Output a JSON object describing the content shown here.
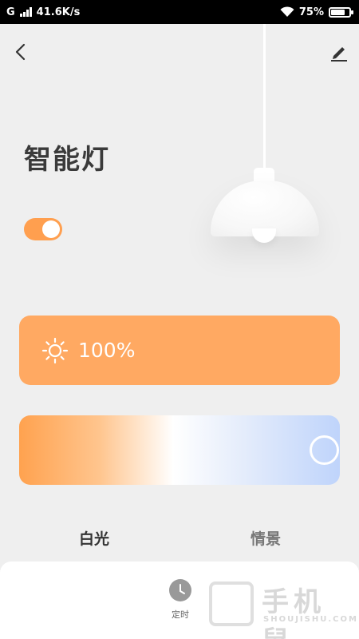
{
  "status_bar": {
    "network_label": "G",
    "speed": "41.6K/s",
    "battery_text": "75%",
    "battery_level": 0.75
  },
  "device": {
    "title": "智能灯",
    "power_on": true
  },
  "brightness": {
    "value_text": "100%",
    "level": 1.0
  },
  "color_temperature": {
    "gradient_colors": [
      "#ffa24f",
      "#ffffff",
      "#bfd4fb"
    ],
    "level": 1.0
  },
  "tabs": {
    "white_light": "白光",
    "scene": "情景"
  },
  "bottom": {
    "timer_label": "定时"
  },
  "watermark": {
    "brand": "手机鼠",
    "sub": "SHOUJISHU.COM"
  },
  "colors": {
    "accent": "#ff9f4f",
    "brightness_card": "#ffa962",
    "background": "#efefef"
  }
}
